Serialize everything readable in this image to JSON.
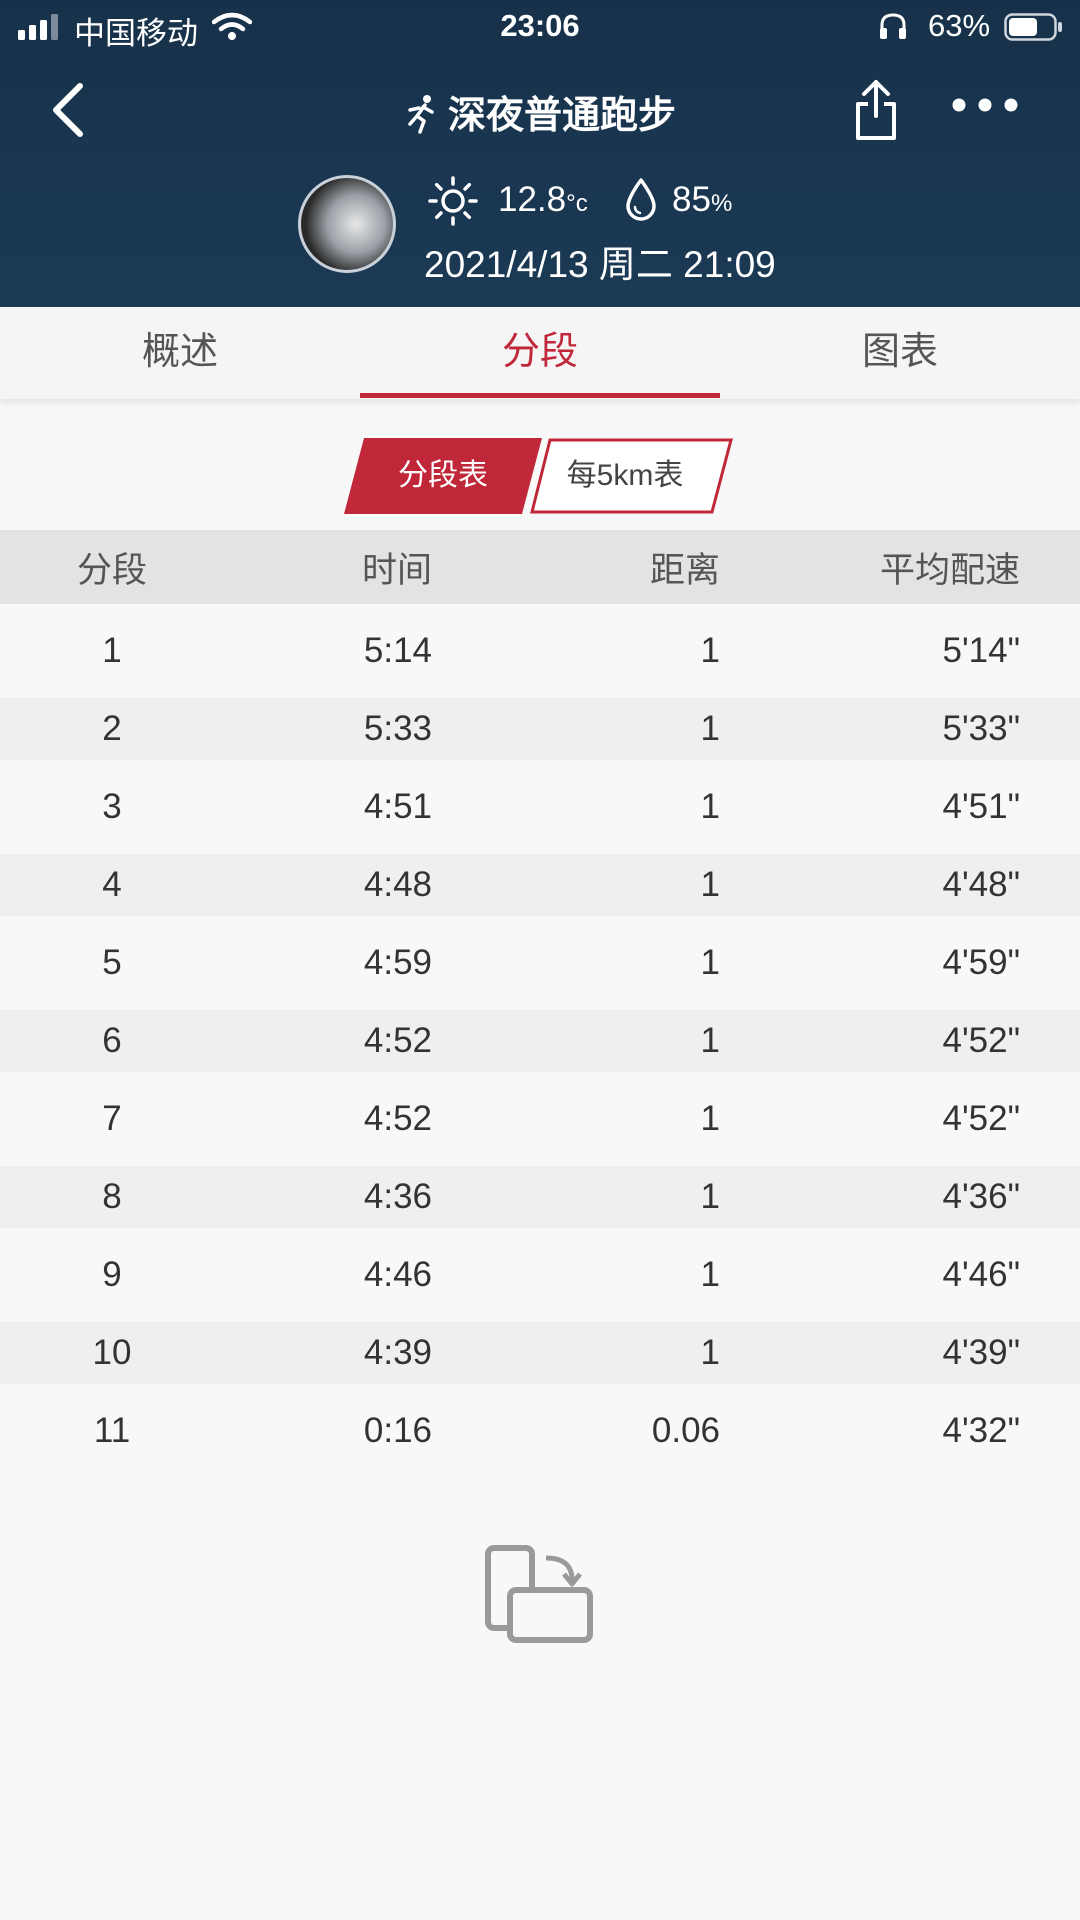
{
  "status_bar": {
    "carrier": "中国移动",
    "time": "23:06",
    "battery": "63%"
  },
  "nav": {
    "title": "深夜普通跑步"
  },
  "weather": {
    "temperature": "12.8",
    "temperature_unit": "°c",
    "humidity": "85",
    "humidity_unit": "%",
    "datetime": "2021/4/13 周二 21:09"
  },
  "tabs": [
    {
      "label": "概述",
      "active": false
    },
    {
      "label": "分段",
      "active": true
    },
    {
      "label": "图表",
      "active": false
    }
  ],
  "segment_toggle": {
    "left_label": "分段表",
    "right_label": "每5km表",
    "selected": "分段表"
  },
  "table": {
    "headers": [
      "分段",
      "时间",
      "距离",
      "平均配速"
    ],
    "rows": [
      [
        "1",
        "5:14",
        "1",
        "5'14\""
      ],
      [
        "2",
        "5:33",
        "1",
        "5'33\""
      ],
      [
        "3",
        "4:51",
        "1",
        "4'51\""
      ],
      [
        "4",
        "4:48",
        "1",
        "4'48\""
      ],
      [
        "5",
        "4:59",
        "1",
        "4'59\""
      ],
      [
        "6",
        "4:52",
        "1",
        "4'52\""
      ],
      [
        "7",
        "4:52",
        "1",
        "4'52\""
      ],
      [
        "8",
        "4:36",
        "1",
        "4'36\""
      ],
      [
        "9",
        "4:46",
        "1",
        "4'46\""
      ],
      [
        "10",
        "4:39",
        "1",
        "4'39\""
      ],
      [
        "11",
        "0:16",
        "0.06",
        "4'32\""
      ]
    ]
  },
  "colors": {
    "header_bg": "#1a3550",
    "accent": "#c0283a"
  }
}
